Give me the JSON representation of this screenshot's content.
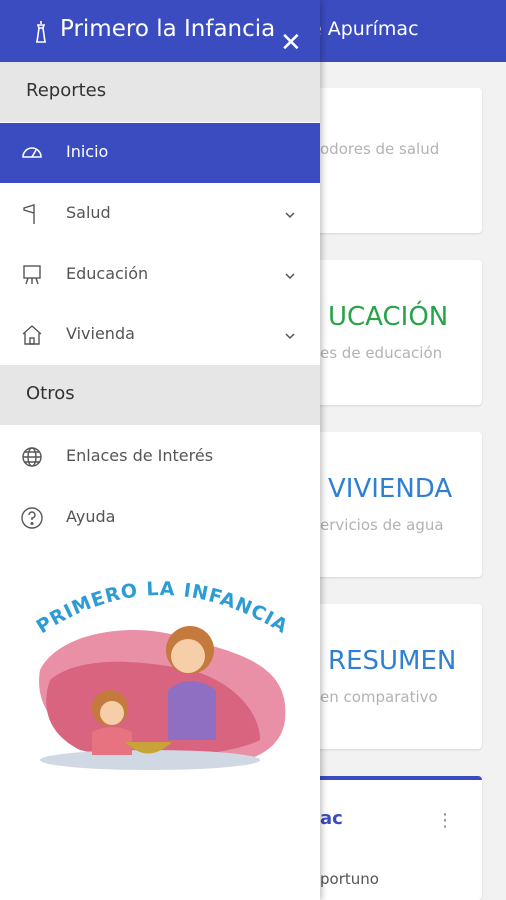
{
  "background": {
    "header_title": "e Apurímac",
    "cards": [
      {
        "title": "",
        "subtitle": "odores de salud",
        "title_color": "#27a34a"
      },
      {
        "title": "UCACIÓN",
        "subtitle": "es de educación",
        "title_color": "#27a34a"
      },
      {
        "title": "VIVIENDA",
        "subtitle": "ervicios de agua",
        "title_color": "#2f7fd3"
      },
      {
        "title": "RESUMEN",
        "subtitle": "en comparativo",
        "title_color": "#2f7fd3"
      }
    ],
    "bottom_card": {
      "title": "ac",
      "subtitle": "portuno"
    }
  },
  "drawer": {
    "title": "Primero la Infancia",
    "sections": [
      {
        "label": "Reportes",
        "items": [
          {
            "label": "Inicio",
            "icon": "gauge-icon",
            "active": true
          },
          {
            "label": "Salud",
            "icon": "flag-icon",
            "expandable": true
          },
          {
            "label": "Educación",
            "icon": "easel-icon",
            "expandable": true
          },
          {
            "label": "Vivienda",
            "icon": "house-icon",
            "expandable": true
          }
        ]
      },
      {
        "label": "Otros",
        "items": [
          {
            "label": "Enlaces de Interés",
            "icon": "globe-icon"
          },
          {
            "label": "Ayuda",
            "icon": "help-icon"
          }
        ]
      }
    ],
    "illustration_text": "PRIMERO LA INFANCIA"
  },
  "colors": {
    "primary": "#3a4cc0",
    "green": "#27a34a",
    "blue": "#2f7fd3"
  }
}
